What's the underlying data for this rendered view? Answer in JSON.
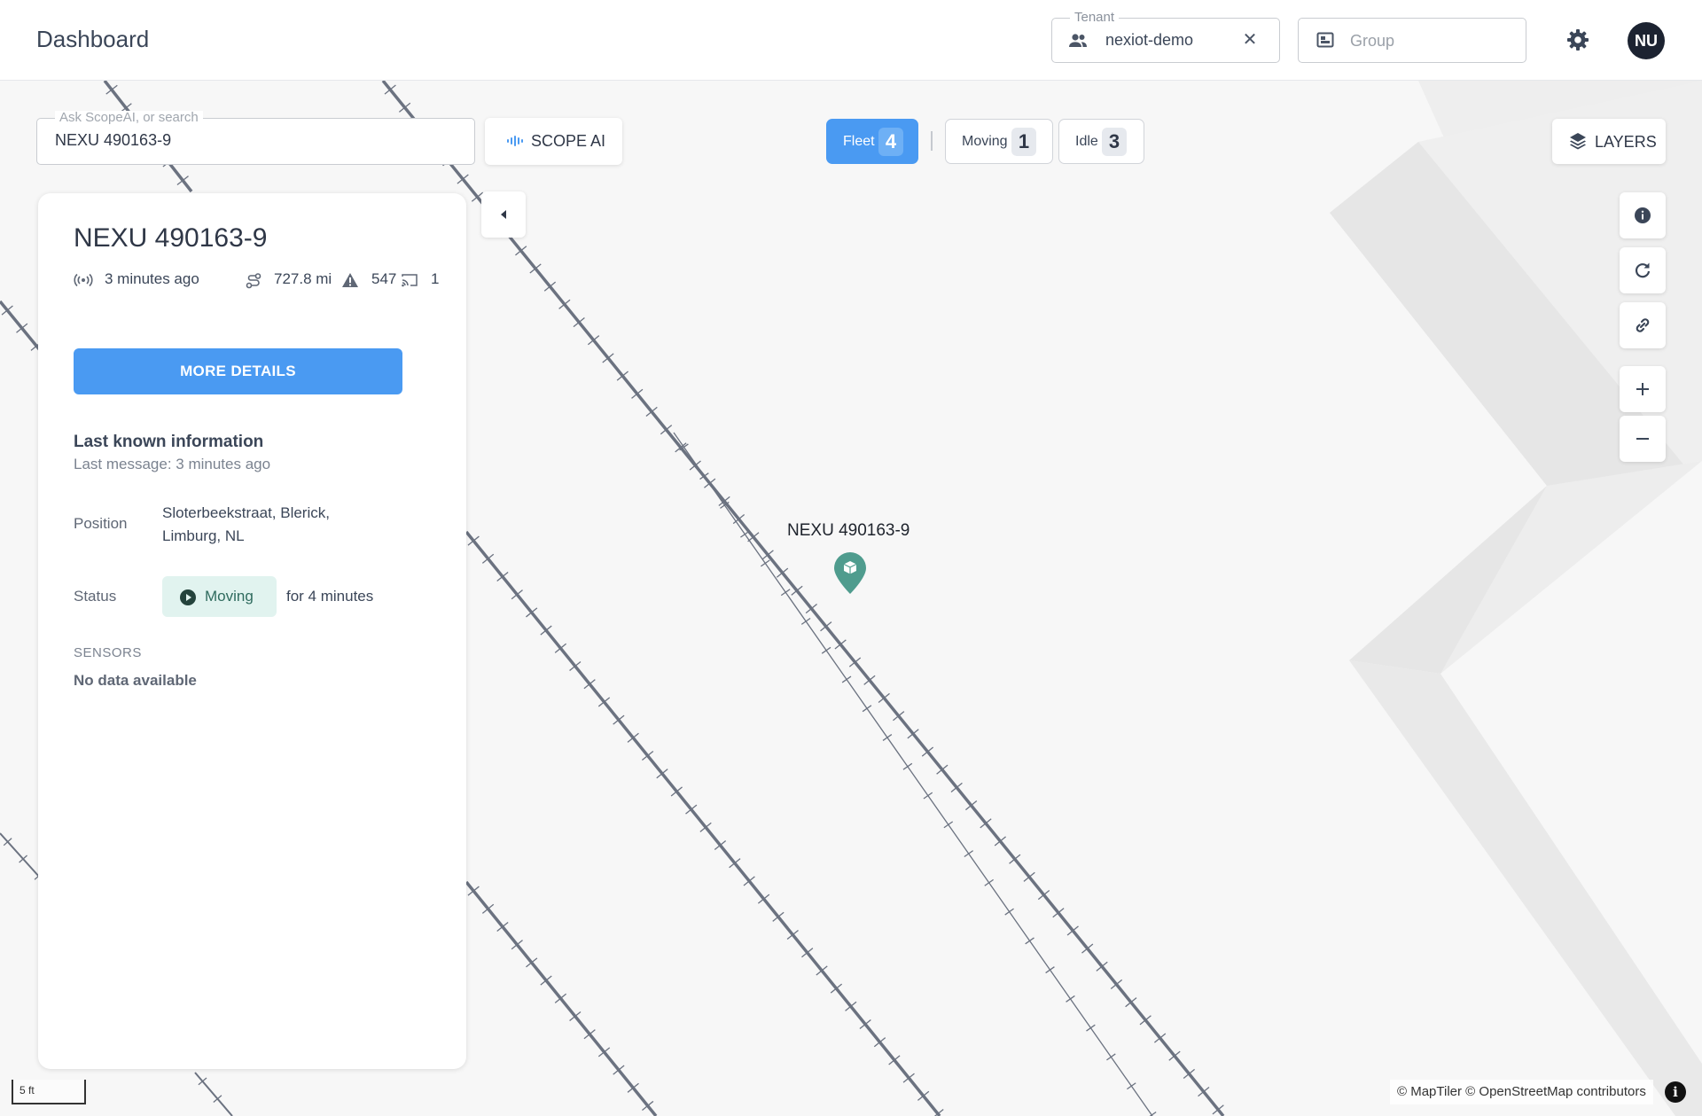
{
  "header": {
    "title": "Dashboard",
    "tenant": {
      "legend": "Tenant",
      "value": "nexiot-demo",
      "clear": "✕"
    },
    "group": {
      "placeholder": "Group"
    },
    "user_initials": "NU"
  },
  "search": {
    "legend": "Ask ScopeAI, or search",
    "value": "NEXU 490163-9"
  },
  "scope_ai": {
    "label": "SCOPE AI"
  },
  "filters": [
    {
      "label": "Fleet",
      "count": "4",
      "active": true
    },
    {
      "label": "Moving",
      "count": "1",
      "active": false
    },
    {
      "label": "Idle",
      "count": "3",
      "active": false
    }
  ],
  "layers": {
    "label": "LAYERS"
  },
  "panel": {
    "title": "NEXU 490163-9",
    "stats": {
      "last_seen": "3 minutes ago",
      "distance": "727.8 mi",
      "alerts": "547",
      "devices": "1"
    },
    "more_details": "MORE DETAILS",
    "last_known": {
      "title": "Last known information",
      "subtitle": "Last message: 3 minutes ago"
    },
    "position": {
      "label": "Position",
      "line1": "Sloterbeekstraat, Blerick,",
      "line2": "Limburg, NL"
    },
    "status": {
      "label": "Status",
      "value": "Moving",
      "duration": "for 4 minutes"
    },
    "sensors": {
      "title": "SENSORS",
      "value": "No data available"
    }
  },
  "map": {
    "marker_label": "NEXU 490163-9",
    "scale": "5 ft",
    "attribution": "© MapTiler © OpenStreetMap contributors",
    "attribution_info": "i"
  },
  "colors": {
    "primary": "#4a9af2",
    "marker": "#4f9c8e",
    "rail": "#6b7280",
    "status_bg": "#e1f3ef"
  },
  "icons": [
    "people-icon",
    "group-icon",
    "gear-icon",
    "waveform-icon",
    "layers-icon",
    "info-icon",
    "refresh-icon",
    "link-icon",
    "zoom-in-icon",
    "zoom-out-icon",
    "chevron-left-icon",
    "signal-icon",
    "route-icon",
    "warning-icon",
    "cast-icon",
    "play-circle-icon",
    "map-pin-icon"
  ]
}
